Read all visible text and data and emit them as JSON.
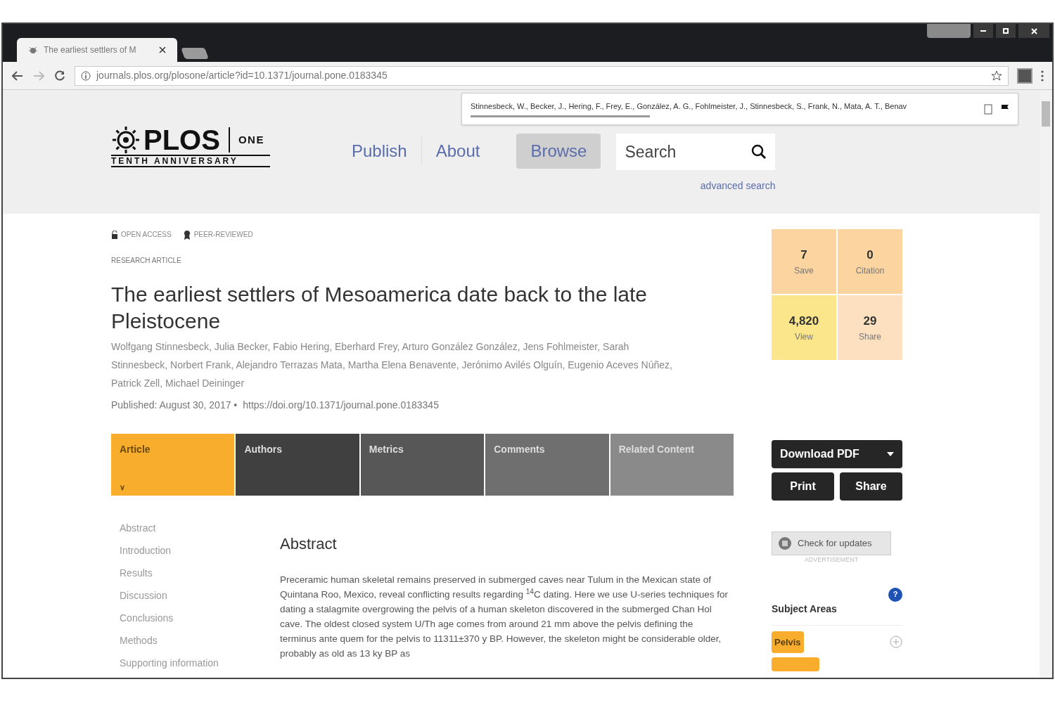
{
  "browser": {
    "tab_title": "The earliest settlers of M",
    "url": "journals.plos.org/plosone/article?id=10.1371/journal.pone.0183345"
  },
  "extension_popup": {
    "text": "Stinnesbeck, W., Becker, J., Hering, F., Frey, E., González, A. G., Fohlmeister, J., Stinnesbeck, S., Frank, N., Mata, A. T., Benav"
  },
  "header": {
    "logo": "PLOS",
    "logo_journal": "ONE",
    "logo_tagline": "TENTH ANNIVERSARY",
    "nav": [
      {
        "label": "Publish",
        "selected": false
      },
      {
        "label": "About",
        "selected": false
      },
      {
        "label": "Browse",
        "selected": true
      }
    ],
    "search": {
      "placeholder": "Search"
    },
    "advanced_search": "advanced search"
  },
  "article": {
    "badges": [
      "OPEN ACCESS",
      "PEER-REVIEWED"
    ],
    "type": "RESEARCH ARTICLE",
    "title": "The earliest settlers of Mesoamerica date back to the late Pleistocene",
    "authors": "Wolfgang Stinnesbeck, Julia Becker, Fabio Hering, Eberhard Frey, Arturo González González, Jens Fohlmeister, Sarah Stinnesbeck, Norbert Frank, Alejandro Terrazas Mata, Martha Elena Benavente, Jerónimo Avilés Olguín, Eugenio Aceves Núñez, Patrick Zell, Michael Deininger",
    "published": "Published: August 30, 2017 •",
    "doi": "https://doi.org/10.1371/journal.pone.0183345"
  },
  "tabs": [
    {
      "label": "Article",
      "selected": true,
      "chevron": "∨"
    },
    {
      "label": "Authors",
      "selected": false
    },
    {
      "label": "Metrics",
      "selected": false
    },
    {
      "label": "Comments",
      "selected": false
    },
    {
      "label": "Related Content",
      "selected": false
    }
  ],
  "toc": [
    "Abstract",
    "Introduction",
    "Results",
    "Discussion",
    "Conclusions",
    "Methods",
    "Supporting information"
  ],
  "abstract": {
    "heading": "Abstract",
    "text": "Preceramic human skeletal remains preserved in submerged caves near Tulum in the Mexican state of Quintana Roo, Mexico, reveal conflicting results regarding $^{14}$C dating. Here we use U-series techniques for dating a stalagmite overgrowing the pelvis of a human skeleton discovered in the submerged Chan Hol cave. The oldest closed system U/Th age comes from around 21 mm above the pelvis defining the terminus ante quem for the pelvis to 11311±370 y BP. However, the skeleton might be considerable older, probably as old as 13 ky BP as"
  },
  "metrics": [
    {
      "value": "7",
      "label": "Save",
      "color": "#fbd49f"
    },
    {
      "value": "0",
      "label": "Citation",
      "color": "#fbd49f"
    },
    {
      "value": "4,820",
      "label": "View",
      "color": "#fbe68c"
    },
    {
      "value": "29",
      "label": "Share",
      "color": "#fce0c0"
    }
  ],
  "actions": {
    "download": "Download PDF",
    "print": "Print",
    "share": "Share"
  },
  "updates": {
    "label": "Check for updates",
    "ad": "ADVERTISEMENT"
  },
  "subject_areas": {
    "heading": "Subject Areas",
    "info": "?",
    "tags": [
      "Pelvis"
    ]
  }
}
